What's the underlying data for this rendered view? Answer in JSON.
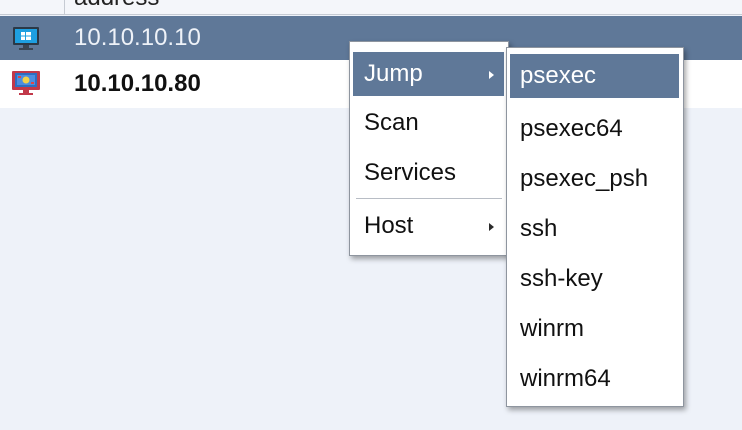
{
  "header": {
    "column_label": "address"
  },
  "rows": [
    {
      "ip": "10.10.10.10",
      "os": "windows",
      "selected": true
    },
    {
      "ip": "10.10.10.80",
      "os": "windows-compromised",
      "selected": false
    }
  ],
  "context_menu": {
    "items": [
      {
        "label": "Jump",
        "submenu": true,
        "highlighted": true
      },
      {
        "label": "Scan",
        "submenu": false
      },
      {
        "label": "Services",
        "submenu": false
      },
      {
        "label": "Host",
        "submenu": true
      }
    ]
  },
  "jump_submenu": {
    "items": [
      "psexec",
      "psexec64",
      "psexec_psh",
      "ssh",
      "ssh-key",
      "winrm",
      "winrm64"
    ],
    "highlighted": "psexec"
  },
  "colors": {
    "selection": "#5f7898",
    "background": "#eef2f9",
    "menu_bg": "#ffffff"
  }
}
